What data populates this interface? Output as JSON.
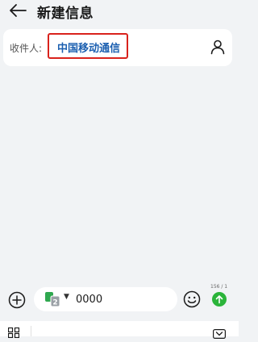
{
  "header": {
    "title": "新建信息"
  },
  "recipient": {
    "label": "收件人:",
    "name": "中国移动通信"
  },
  "compose": {
    "sim_number": "2",
    "message_value": "0000",
    "char_counter": "156 / 1"
  },
  "colors": {
    "background": "#f1f3f5",
    "recipient_text": "#1b5fb0",
    "highlight_border": "#d9221c",
    "send_button": "#2bb43a",
    "sim_green": "#2fa84f"
  },
  "icons": [
    "back-arrow-icon",
    "contact-icon",
    "add-icon",
    "sim-card-icon",
    "dropdown-icon",
    "emoji-icon",
    "send-icon",
    "apps-icon",
    "collapse-keyboard-icon"
  ]
}
